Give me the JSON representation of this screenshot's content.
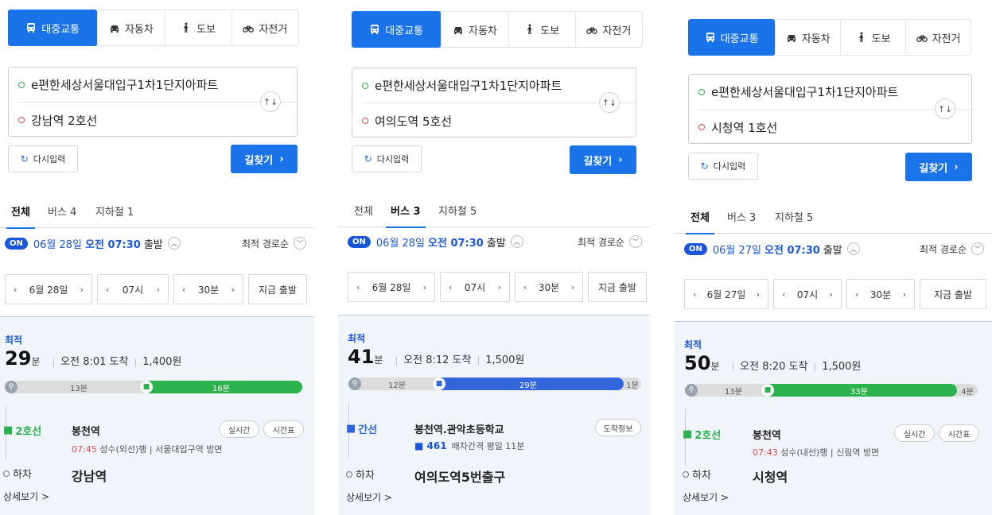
{
  "modes": [
    "대중교통",
    "자동차",
    "도보",
    "자전거"
  ],
  "reset_label": "다시입력",
  "search_label": "길찾기",
  "depart_suffix": "출발",
  "sort_label": "최적 경로순",
  "now_label": "지금 출발",
  "best_label": "최적",
  "minute_unit": "분",
  "arrive_prefix": "오전",
  "arrive_suffix": "도착",
  "getoff_label": "하차",
  "more_label": "상세보기 >",
  "colors": {
    "accent": "#1a73e8",
    "line2": "#2bb24c",
    "bus": "#3366dd"
  },
  "panels": [
    {
      "origin": "e편한세상서울대입구1차1단지아파트",
      "destination": "강남역 2호선",
      "tabs": [
        "전체",
        "버스 4",
        "지하철 1"
      ],
      "on": "ON",
      "date": "06월 28일",
      "time": "오전 07:30",
      "tb_date": "6월 28일",
      "tb_hour": "07시",
      "tb_min": "30분",
      "duration": "29",
      "arrival": "오전 8:01 도착",
      "fare": "1,400원",
      "bar_walk": "13분",
      "bar_ride": "16분",
      "line": "2호선",
      "board": "봉천역",
      "pill1": "실시간",
      "pill2": "시간표",
      "sub_time": "07:45",
      "sub_text": "성수(외선)행 | 서울대입구역 방면",
      "alight": "강남역"
    },
    {
      "origin": "e편한세상서울대입구1차1단지아파트",
      "destination": "여의도역 5호선",
      "tabs": [
        "전체",
        "버스 3",
        "지하철 5"
      ],
      "on": "ON",
      "date": "06월 28일",
      "time": "오전 07:30",
      "tb_date": "6월 28일",
      "tb_hour": "07시",
      "tb_min": "30분",
      "duration": "41",
      "arrival": "오전 8:12 도착",
      "fare": "1,500원",
      "bar_walk": "12분",
      "bar_ride": "29분",
      "bar_end": "1분",
      "line": "간선",
      "board": "봉천역.관악초등학교",
      "pill1": "도착정보",
      "bus_no": "461",
      "sub_text": "배차간격 평일 11분",
      "alight": "여의도역5번출구"
    },
    {
      "origin": "e편한세상서울대입구1차1단지아파트",
      "destination": "시청역 1호선",
      "tabs": [
        "전체",
        "버스 3",
        "지하철 5"
      ],
      "on": "ON",
      "date": "06월 27일",
      "time": "오전 07:30",
      "tb_date": "6월 27일",
      "tb_hour": "07시",
      "tb_min": "30분",
      "duration": "50",
      "arrival": "오전 8:20 도착",
      "fare": "1,500원",
      "bar_walk": "13분",
      "bar_ride": "33분",
      "bar_end": "4분",
      "line": "2호선",
      "board": "봉천역",
      "pill1": "실시간",
      "pill2": "시간표",
      "sub_time": "07:43",
      "sub_text": "성수(내선)행 | 신림역 방면",
      "alight": "시청역"
    }
  ]
}
